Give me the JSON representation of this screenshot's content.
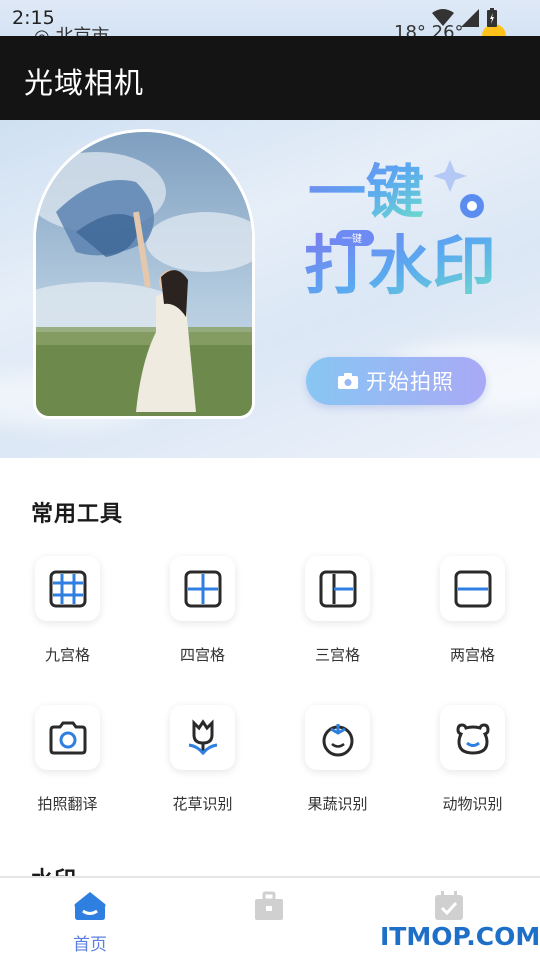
{
  "status_bar": {
    "time": "2:15",
    "location": "北京市",
    "weather": "18° 26°"
  },
  "app_bar": {
    "title": "光域相机"
  },
  "banner": {
    "logo_main": "一键打水印",
    "logo_small": "一键",
    "start_button": "开始拍照"
  },
  "tools": {
    "section_title": "常用工具",
    "items": [
      {
        "label": "九宫格",
        "icon": "grid-nine-icon"
      },
      {
        "label": "四宫格",
        "icon": "grid-four-icon"
      },
      {
        "label": "三宫格",
        "icon": "grid-three-icon"
      },
      {
        "label": "两宫格",
        "icon": "grid-two-icon"
      },
      {
        "label": "拍照翻译",
        "icon": "camera-icon"
      },
      {
        "label": "花草识别",
        "icon": "tulip-icon"
      },
      {
        "label": "果蔬识别",
        "icon": "tomato-icon"
      },
      {
        "label": "动物识别",
        "icon": "bear-icon"
      }
    ]
  },
  "watermark_section": {
    "title": "水印"
  },
  "bottom_nav": {
    "items": [
      {
        "label": "首页",
        "icon": "home-icon"
      },
      {
        "label": "",
        "icon": "toolbox-icon"
      },
      {
        "label": "",
        "icon": "calendar-check-icon"
      }
    ]
  },
  "site_watermark": "ITMOP.COM",
  "colors": {
    "accent": "#2f7fe0",
    "nav_active": "#5a7fe0",
    "app_bar": "#141414"
  }
}
